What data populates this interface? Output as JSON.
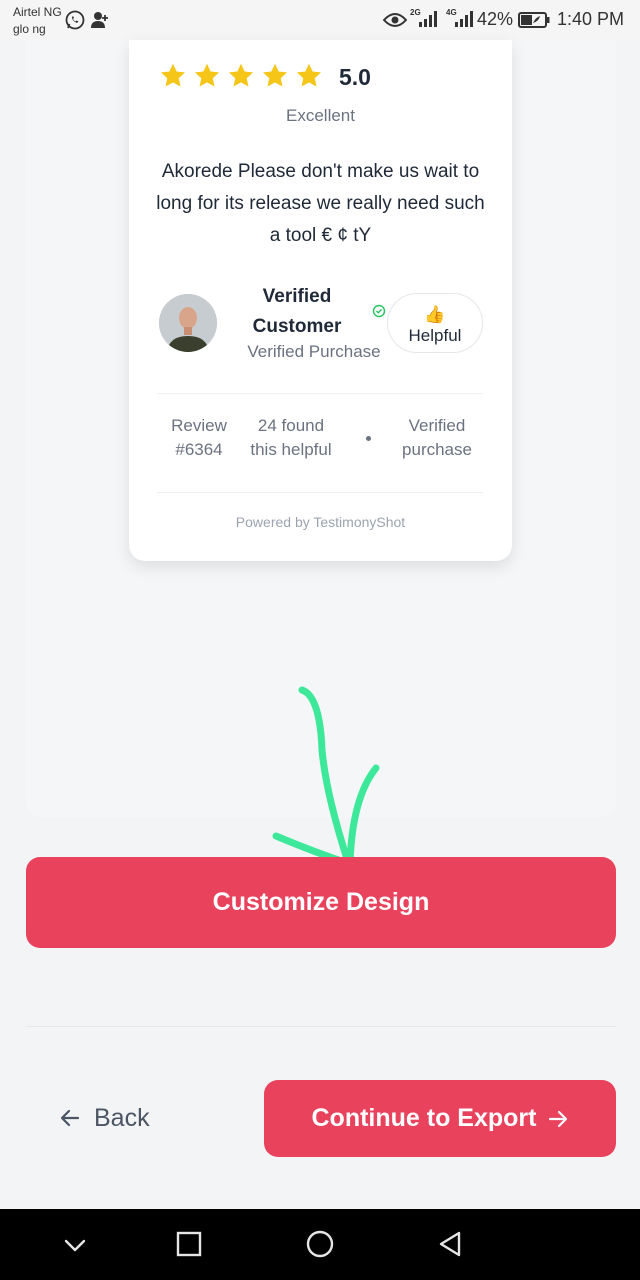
{
  "status_bar": {
    "carrier_line1": "Airtel NG",
    "carrier_line2": "glo ng",
    "net_2g": "2G",
    "net_4g": "4G",
    "battery_percent": "42%",
    "time": "1:40 PM",
    "icons": [
      "whatsapp-icon",
      "add-contact-icon",
      "eye-icon",
      "signal-icon",
      "battery-icon"
    ]
  },
  "review": {
    "rating_value": "5.0",
    "star_count": 5,
    "rating_label": "Excellent",
    "text": "Akorede Please don't make us wait to long for its release we really need such a tool € ¢ tY",
    "customer_name": "Verified Customer",
    "customer_subtitle": "Verified Purchase",
    "helpful_emoji": "👍",
    "helpful_label": "Helpful",
    "stats": {
      "review_line1": "Review",
      "review_line2": "#6364",
      "found_line1": "24 found",
      "found_line2": "this helpful",
      "verified_line1": "Verified",
      "verified_line2": "purchase"
    },
    "powered_by": "Powered by TestimonyShot"
  },
  "actions": {
    "customize_label": "Customize Design",
    "back_label": "Back",
    "continue_label": "Continue to Export"
  },
  "colors": {
    "accent": "#e8425c",
    "star": "#f5c518",
    "annotation": "#3ee89a",
    "verified_badge": "#22c55e"
  }
}
